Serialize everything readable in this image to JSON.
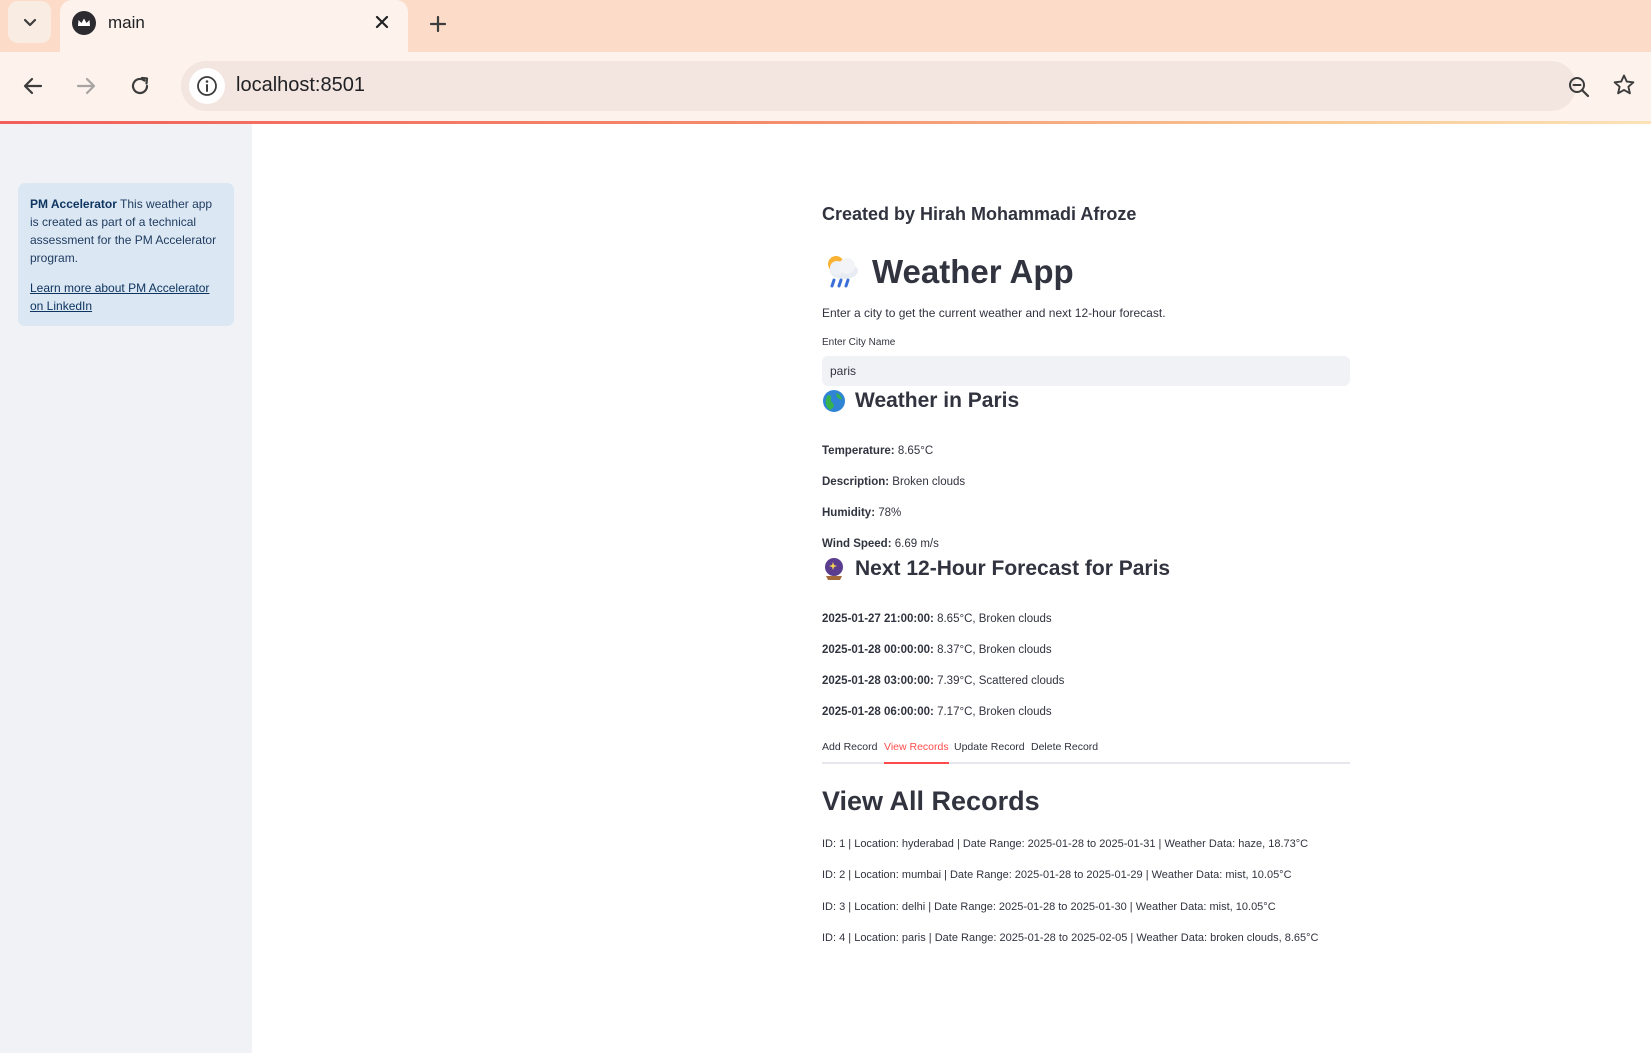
{
  "browser": {
    "tab_title": "main",
    "url": "localhost:8501"
  },
  "sidebar": {
    "info_bold": "PM Accelerator",
    "info_text": " This weather app is created as part of a technical assessment for the PM Accelerator program.",
    "link_text": "Learn more about PM Accelerator on LinkedIn"
  },
  "main": {
    "created_by": "Created by Hirah Mohammadi Afroze",
    "title": "Weather App",
    "subtitle": "Enter a city to get the current weather and next 12-hour forecast.",
    "input_label": "Enter City Name",
    "input_value": "paris",
    "current": {
      "heading": "Weather in Paris",
      "rows": [
        {
          "label": "Temperature:",
          "value": " 8.65°C"
        },
        {
          "label": "Description:",
          "value": " Broken clouds"
        },
        {
          "label": "Humidity:",
          "value": " 78%"
        },
        {
          "label": "Wind Speed:",
          "value": " 6.69 m/s"
        }
      ]
    },
    "forecast": {
      "heading": "Next 12-Hour Forecast for Paris",
      "rows": [
        {
          "label": "2025-01-27 21:00:00:",
          "value": " 8.65°C, Broken clouds"
        },
        {
          "label": "2025-01-28 00:00:00:",
          "value": " 8.37°C, Broken clouds"
        },
        {
          "label": "2025-01-28 03:00:00:",
          "value": " 7.39°C, Scattered clouds"
        },
        {
          "label": "2025-01-28 06:00:00:",
          "value": " 7.17°C, Broken clouds"
        }
      ]
    },
    "tabs": [
      "Add Record",
      "View Records",
      "Update Record",
      "Delete Record"
    ],
    "active_tab": "View Records",
    "records_title": "View All Records",
    "records": [
      "ID: 1 | Location: hyderabad | Date Range: 2025-01-28 to 2025-01-31 | Weather Data: haze, 18.73°C",
      "ID: 2 | Location: mumbai | Date Range: 2025-01-28 to 2025-01-29 | Weather Data: mist, 10.05°C",
      "ID: 3 | Location: delhi | Date Range: 2025-01-28 to 2025-01-30 | Weather Data: mist, 10.05°C",
      "ID: 4 | Location: paris | Date Range: 2025-01-28 to 2025-02-05 | Weather Data: broken clouds, 8.65°C"
    ]
  },
  "colors": {
    "accent": "#ff4b4b",
    "sidebar_bg": "#f0f2f6",
    "info_box_bg": "#dbe7f3",
    "chrome_tabstrip": "#fcdcc8",
    "chrome_toolbar": "#fdf2ec"
  }
}
